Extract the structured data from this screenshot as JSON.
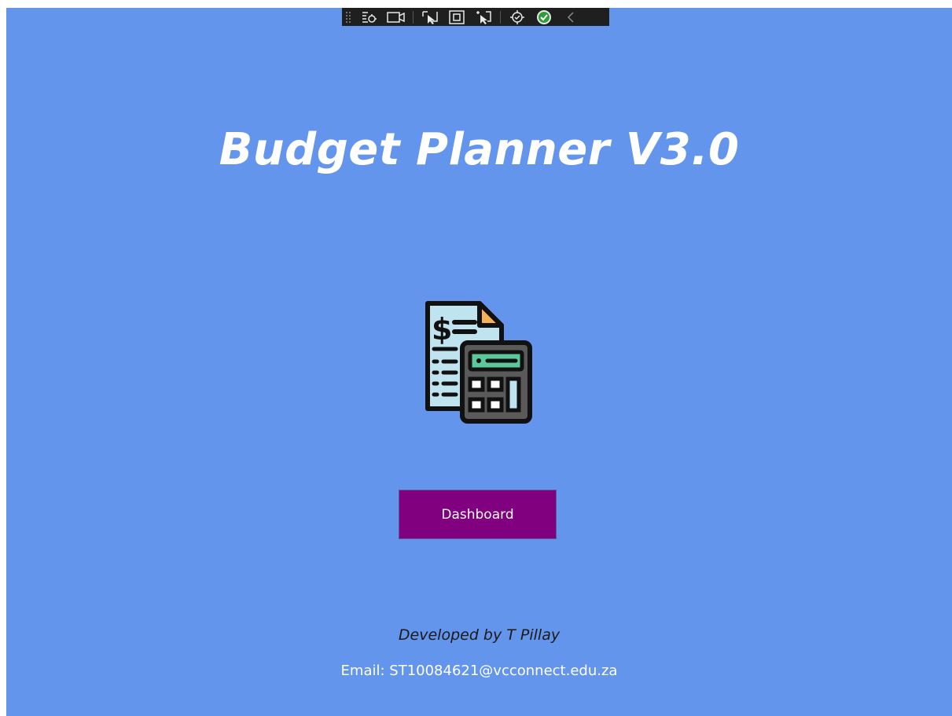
{
  "window": {
    "background": "#6495ed"
  },
  "dev_toolbar": {
    "background": "#1f1f1f",
    "tools": [
      {
        "icon": "select-element-icon"
      },
      {
        "icon": "video-icon"
      },
      {
        "icon": "pointer-select-icon"
      },
      {
        "icon": "layout-adorners-icon"
      },
      {
        "icon": "track-focus-icon"
      },
      {
        "icon": "settings-icon"
      },
      {
        "icon": "check-ok-icon"
      },
      {
        "icon": "collapse-chevron-icon"
      }
    ]
  },
  "main": {
    "title": "Budget Planner V3.0",
    "logo": {
      "icon": "budget-calculator-icon"
    },
    "dashboard_button": {
      "label": "Dashboard",
      "color": "#800080"
    },
    "footer": {
      "credit": "Developed by T Pillay",
      "email": "Email: ST10084621@vcconnect.edu.za"
    }
  }
}
